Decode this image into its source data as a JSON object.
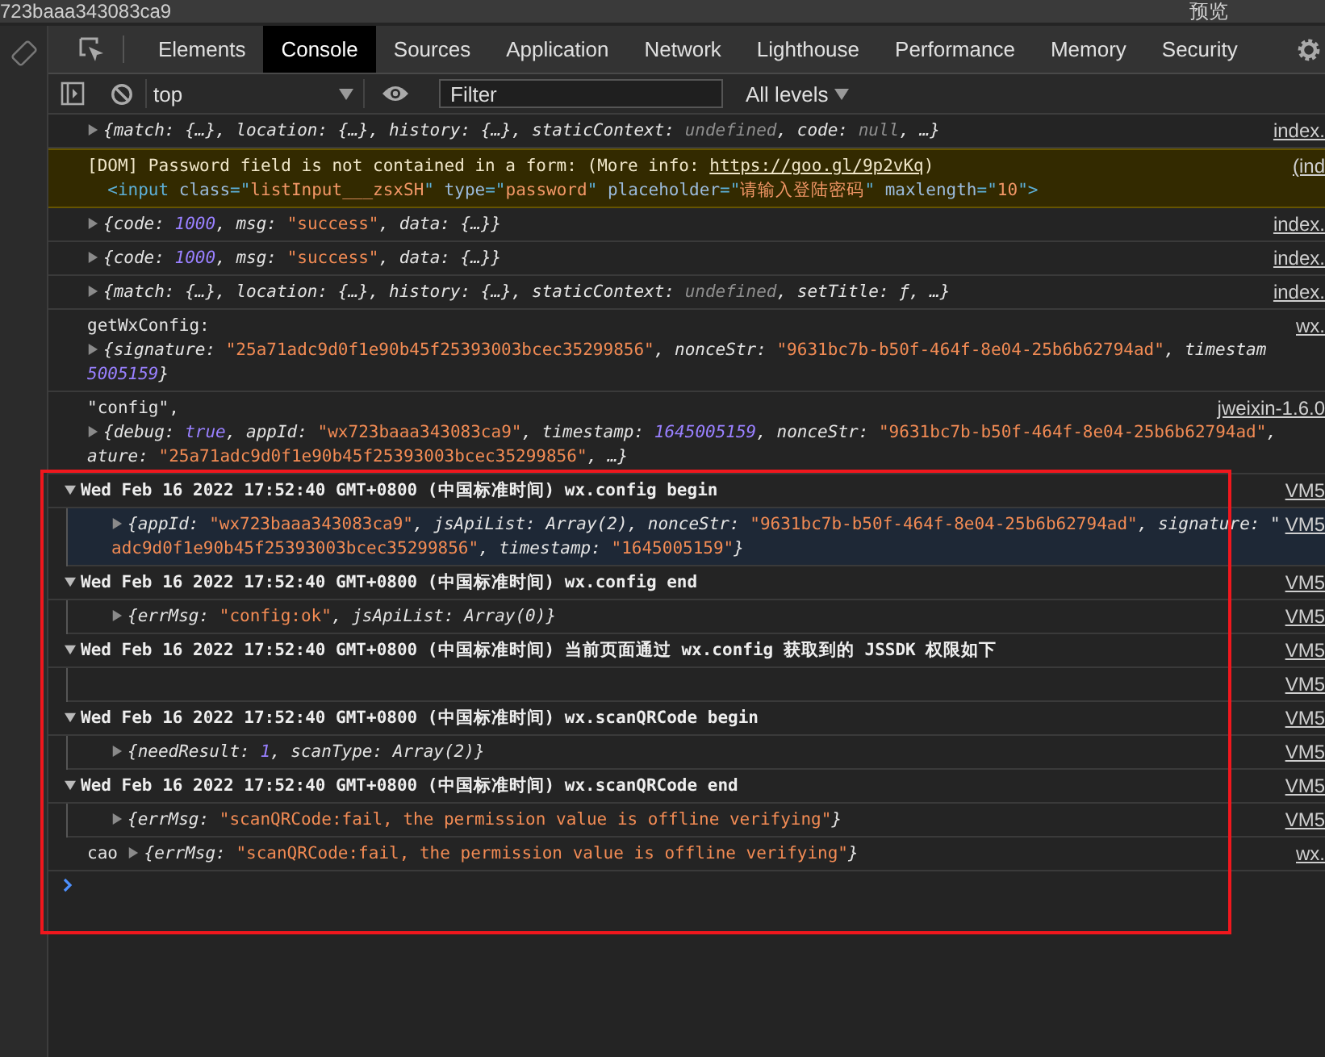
{
  "top_strip": {
    "url": "723baaa343083ca9",
    "actions": [
      "预览"
    ]
  },
  "tabs": [
    {
      "label": "Elements",
      "selected": false
    },
    {
      "label": "Console",
      "selected": true
    },
    {
      "label": "Sources",
      "selected": false
    },
    {
      "label": "Application",
      "selected": false
    },
    {
      "label": "Network",
      "selected": false
    },
    {
      "label": "Lighthouse",
      "selected": false
    },
    {
      "label": "Performance",
      "selected": false
    },
    {
      "label": "Memory",
      "selected": false
    },
    {
      "label": "Security",
      "selected": false
    }
  ],
  "toolbar": {
    "context": "top",
    "filter": {
      "placeholder": "Filter"
    },
    "levels": "All levels"
  },
  "console": {
    "highlight_frame": true,
    "messages": [
      {
        "kind": "log",
        "source": "index.",
        "lines": [
          [
            {
              "kind": "toggle",
              "expanded": false
            },
            {
              "kind": "obj",
              "text": "{match: {…}, location: {…}, history: {…}, staticContext: "
            },
            {
              "kind": "keyword",
              "text": "undefined"
            },
            {
              "kind": "obj",
              "text": ", code: "
            },
            {
              "kind": "keyword",
              "text": "null"
            },
            {
              "kind": "obj",
              "text": ", …}"
            }
          ]
        ]
      },
      {
        "kind": "warning",
        "source": "(ind",
        "lines": [
          [
            {
              "kind": "text",
              "text": "[DOM] Password field is not contained in a form: (More info: "
            },
            {
              "kind": "link",
              "text": "https://goo.gl/9p2vKq"
            },
            {
              "kind": "text",
              "text": ")"
            }
          ],
          [
            {
              "kind": "tag",
              "text": "  <input "
            },
            {
              "kind": "attr",
              "text": "class"
            },
            {
              "kind": "tag",
              "text": "=\""
            },
            {
              "kind": "value",
              "text": "listInput___zsxSH"
            },
            {
              "kind": "tag",
              "text": "\" "
            },
            {
              "kind": "attr",
              "text": "type"
            },
            {
              "kind": "tag",
              "text": "=\""
            },
            {
              "kind": "value",
              "text": "password"
            },
            {
              "kind": "tag",
              "text": "\" "
            },
            {
              "kind": "attr",
              "text": "placeholder"
            },
            {
              "kind": "tag",
              "text": "=\""
            },
            {
              "kind": "value",
              "text": "请输入登陆密码"
            },
            {
              "kind": "tag",
              "text": "\" "
            },
            {
              "kind": "attr",
              "text": "maxlength"
            },
            {
              "kind": "tag",
              "text": "=\""
            },
            {
              "kind": "value",
              "text": "10"
            },
            {
              "kind": "tag",
              "text": "\">"
            }
          ]
        ]
      },
      {
        "kind": "log",
        "source": "index.",
        "lines": [
          [
            {
              "kind": "toggle",
              "expanded": false
            },
            {
              "kind": "obj",
              "text": "{code: "
            },
            {
              "kind": "number",
              "text": "1000"
            },
            {
              "kind": "obj",
              "text": ", msg: "
            },
            {
              "kind": "string",
              "text": "\"success\""
            },
            {
              "kind": "obj",
              "text": ", data: {…}}"
            }
          ]
        ]
      },
      {
        "kind": "log",
        "source": "index.",
        "lines": [
          [
            {
              "kind": "toggle",
              "expanded": false
            },
            {
              "kind": "obj",
              "text": "{code: "
            },
            {
              "kind": "number",
              "text": "1000"
            },
            {
              "kind": "obj",
              "text": ", msg: "
            },
            {
              "kind": "string",
              "text": "\"success\""
            },
            {
              "kind": "obj",
              "text": ", data: {…}}"
            }
          ]
        ]
      },
      {
        "kind": "log",
        "source": "index.",
        "lines": [
          [
            {
              "kind": "toggle",
              "expanded": false
            },
            {
              "kind": "obj",
              "text": "{match: {…}, location: {…}, history: {…}, staticContext: "
            },
            {
              "kind": "keyword",
              "text": "undefined"
            },
            {
              "kind": "obj",
              "text": ", setTitle: ƒ, …}"
            }
          ]
        ]
      },
      {
        "kind": "log",
        "source": "wx.",
        "lines": [
          [
            {
              "kind": "text",
              "text": "getWxConfig:"
            }
          ],
          [
            {
              "kind": "toggle",
              "expanded": false
            },
            {
              "kind": "obj",
              "text": "{signature: "
            },
            {
              "kind": "string",
              "text": "\"25a71adc9d0f1e90b45f25393003bcec35299856\""
            },
            {
              "kind": "obj",
              "text": ", nonceStr: "
            },
            {
              "kind": "string",
              "text": "\"9631bc7b-b50f-464f-8e04-25b6b62794ad\""
            },
            {
              "kind": "obj",
              "text": ", timestam"
            }
          ],
          [
            {
              "kind": "number",
              "text": "5005159"
            },
            {
              "kind": "obj",
              "text": "}"
            }
          ]
        ]
      },
      {
        "kind": "log",
        "source": "jweixin-1.6.0",
        "lines": [
          [
            {
              "kind": "text",
              "text": "\"config\","
            }
          ],
          [
            {
              "kind": "toggle",
              "expanded": false
            },
            {
              "kind": "obj",
              "text": "{debug: "
            },
            {
              "kind": "number",
              "text": "true"
            },
            {
              "kind": "obj",
              "text": ", appId: "
            },
            {
              "kind": "string",
              "text": "\"wx723baaa343083ca9\""
            },
            {
              "kind": "obj",
              "text": ", timestamp: "
            },
            {
              "kind": "number",
              "text": "1645005159"
            },
            {
              "kind": "obj",
              "text": ", nonceStr: "
            },
            {
              "kind": "string",
              "text": "\"9631bc7b-b50f-464f-8e04-25b6b62794ad\""
            },
            {
              "kind": "obj",
              "text": ","
            }
          ],
          [
            {
              "kind": "obj",
              "text": "ature: "
            },
            {
              "kind": "string",
              "text": "\"25a71adc9d0f1e90b45f25393003bcec35299856\""
            },
            {
              "kind": "obj",
              "text": ", …}"
            }
          ]
        ]
      },
      {
        "kind": "group",
        "source": "VM5",
        "lines": [
          [
            {
              "kind": "toggle",
              "expanded": true
            },
            {
              "kind": "text",
              "text": "Wed Feb 16 2022 17:52:40 GMT+0800 (中国标准时间) wx.config begin"
            }
          ]
        ],
        "children": [
          {
            "kind": "log",
            "highlighted": true,
            "source": "VM5",
            "lines": [
              [
                {
                  "kind": "toggle",
                  "expanded": false
                },
                {
                  "kind": "obj",
                  "text": "{appId: "
                },
                {
                  "kind": "string",
                  "text": "\"wx723baaa343083ca9\""
                },
                {
                  "kind": "obj",
                  "text": ", jsApiList: Array(2), nonceStr: "
                },
                {
                  "kind": "string",
                  "text": "\"9631bc7b-b50f-464f-8e04-25b6b62794ad\""
                },
                {
                  "kind": "obj",
                  "text": ", signature: \""
                }
              ],
              [
                {
                  "kind": "string",
                  "text": "adc9d0f1e90b45f25393003bcec35299856\""
                },
                {
                  "kind": "obj",
                  "text": ", timestamp: "
                },
                {
                  "kind": "string",
                  "text": "\"1645005159\""
                },
                {
                  "kind": "obj",
                  "text": "}"
                }
              ]
            ]
          }
        ]
      },
      {
        "kind": "group",
        "source": "VM5",
        "lines": [
          [
            {
              "kind": "toggle",
              "expanded": true
            },
            {
              "kind": "text",
              "text": "Wed Feb 16 2022 17:52:40 GMT+0800 (中国标准时间) wx.config end"
            }
          ]
        ],
        "children": [
          {
            "kind": "log",
            "highlighted": false,
            "source": "VM5",
            "lines": [
              [
                {
                  "kind": "toggle",
                  "expanded": false
                },
                {
                  "kind": "obj",
                  "text": "{errMsg: "
                },
                {
                  "kind": "string",
                  "text": "\"config:ok\""
                },
                {
                  "kind": "obj",
                  "text": ", jsApiList: Array(0)}"
                }
              ]
            ]
          }
        ]
      },
      {
        "kind": "group",
        "source": "VM5",
        "lines": [
          [
            {
              "kind": "toggle",
              "expanded": true
            },
            {
              "kind": "text",
              "text": "Wed Feb 16 2022 17:52:40 GMT+0800 (中国标准时间) 当前页面通过 wx.config 获取到的 JSSDK 权限如下"
            }
          ]
        ],
        "children": [
          {
            "kind": "log",
            "highlighted": false,
            "source": "VM5"
          }
        ]
      },
      {
        "kind": "group",
        "source": "VM5",
        "lines": [
          [
            {
              "kind": "toggle",
              "expanded": true
            },
            {
              "kind": "text",
              "text": "Wed Feb 16 2022 17:52:40 GMT+0800 (中国标准时间) wx.scanQRCode begin"
            }
          ]
        ],
        "children": [
          {
            "kind": "log",
            "highlighted": false,
            "source": "VM5",
            "lines": [
              [
                {
                  "kind": "toggle",
                  "expanded": false
                },
                {
                  "kind": "obj",
                  "text": "{needResult: "
                },
                {
                  "kind": "number",
                  "text": "1"
                },
                {
                  "kind": "obj",
                  "text": ", scanType: Array(2)}"
                }
              ]
            ]
          }
        ]
      },
      {
        "kind": "group",
        "source": "VM5",
        "lines": [
          [
            {
              "kind": "toggle",
              "expanded": true
            },
            {
              "kind": "text",
              "text": "Wed Feb 16 2022 17:52:40 GMT+0800 (中国标准时间) wx.scanQRCode end"
            }
          ]
        ],
        "children": [
          {
            "kind": "log",
            "highlighted": false,
            "source": "VM5",
            "lines": [
              [
                {
                  "kind": "toggle",
                  "expanded": false
                },
                {
                  "kind": "obj",
                  "text": "{errMsg: "
                },
                {
                  "kind": "string",
                  "text": "\"scanQRCode:fail, the permission value is offline verifying\""
                },
                {
                  "kind": "obj",
                  "text": "}"
                }
              ]
            ]
          }
        ]
      },
      {
        "kind": "log",
        "source": "wx.",
        "lines": [
          [
            {
              "kind": "text",
              "text": "cao "
            },
            {
              "kind": "toggle",
              "expanded": false
            },
            {
              "kind": "obj",
              "text": "{errMsg: "
            },
            {
              "kind": "string",
              "text": "\"scanQRCode:fail, the permission value is offline verifying\""
            },
            {
              "kind": "obj",
              "text": "}"
            }
          ]
        ]
      },
      {
        "kind": "prompt"
      }
    ]
  }
}
